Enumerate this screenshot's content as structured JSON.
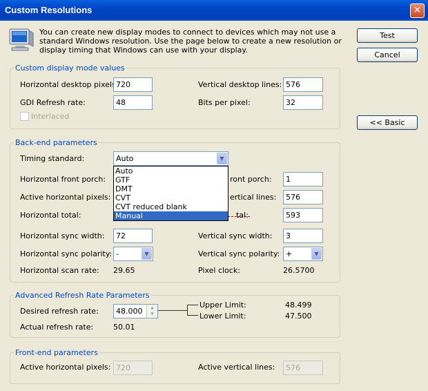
{
  "window": {
    "title": "Custom Resolutions",
    "close_glyph": "✕"
  },
  "intro": "You can create new display modes to connect to devices which may not use a standard Windows resolution. Use the page below to create a new resolution or display timing that Windows can use with your display.",
  "buttons": {
    "test": "Test",
    "cancel": "Cancel",
    "basic": "<< Basic"
  },
  "custom_display": {
    "title": "Custom display mode values",
    "h_desktop_label": "Horizontal desktop pixels:",
    "h_desktop_value": "720",
    "v_desktop_label": "Vertical desktop lines:",
    "v_desktop_value": "576",
    "gdi_label": "GDI Refresh rate:",
    "gdi_value": "48",
    "bpp_label": "Bits per pixel:",
    "bpp_value": "32",
    "interlaced_label": "Interlaced"
  },
  "backend": {
    "title": "Back-end parameters",
    "timing_label": "Timing standard:",
    "timing_value": "Auto",
    "timing_options": [
      "Auto",
      "GTF",
      "DMT",
      "CVT",
      "CVT reduced blank",
      "Manual"
    ],
    "h_front_porch_label": "Horizontal front porch:",
    "v_front_porch_label": "ront porch:",
    "v_front_porch_value": "1",
    "active_h_label": "Active horizontal pixels:",
    "active_v_label": "ertical lines:",
    "active_v_value": "576",
    "h_total_label": "Horizontal total:",
    "v_total_label": "tal:",
    "v_total_value": "593",
    "h_sync_width_label": "Horizontal sync width:",
    "h_sync_width_value": "72",
    "v_sync_width_label": "Vertical sync width:",
    "v_sync_width_value": "3",
    "h_sync_pol_label": "Horizontal sync polarity:",
    "h_sync_pol_value": "-",
    "v_sync_pol_label": "Vertical sync polarity:",
    "v_sync_pol_value": "+",
    "h_scan_label": "Horizontal scan rate:",
    "h_scan_value": "29.65",
    "pixel_clock_label": "Pixel clock:",
    "pixel_clock_value": "26.5700"
  },
  "advanced": {
    "title": "Advanced Refresh Rate Parameters",
    "desired_label": "Desired refresh rate:",
    "desired_value": "48.000",
    "upper_label": "Upper Limit:",
    "upper_value": "48.499",
    "lower_label": "Lower Limit:",
    "lower_value": "47.500",
    "actual_label": "Actual refresh rate:",
    "actual_value": "50.01"
  },
  "frontend": {
    "title": "Front-end parameters",
    "active_h_label": "Active horizontal pixels:",
    "active_h_value": "720",
    "active_v_label": "Active vertical lines:",
    "active_v_value": "576"
  },
  "icons": {
    "monitor": "monitor-icon",
    "dropdown": "chevron-down-icon"
  },
  "colors": {
    "title_bar": "#0046c8",
    "group_title": "#0046d5",
    "selection": "#316ac5",
    "dialog_bg": "#ece9d8"
  }
}
